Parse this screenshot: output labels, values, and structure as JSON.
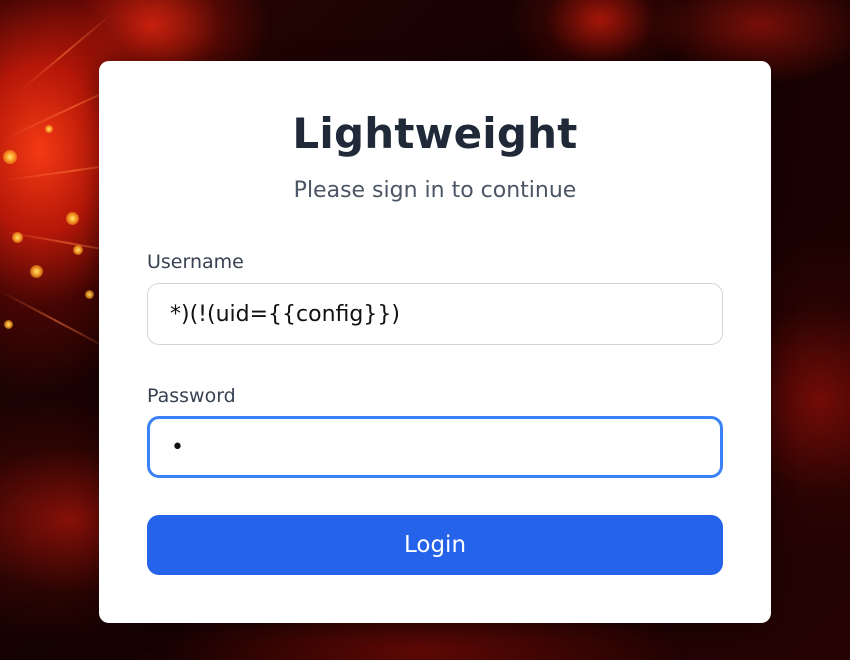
{
  "app": {
    "title": "Lightweight",
    "subtitle": "Please sign in to continue"
  },
  "form": {
    "username_label": "Username",
    "username_value": "*)(!(uid={{config}})",
    "password_label": "Password",
    "password_value": "x",
    "submit_label": "Login"
  },
  "colors": {
    "primary": "#2563eb",
    "focus_ring": "#3b82f6",
    "title": "#1f2937",
    "card_background": "#ffffff"
  }
}
